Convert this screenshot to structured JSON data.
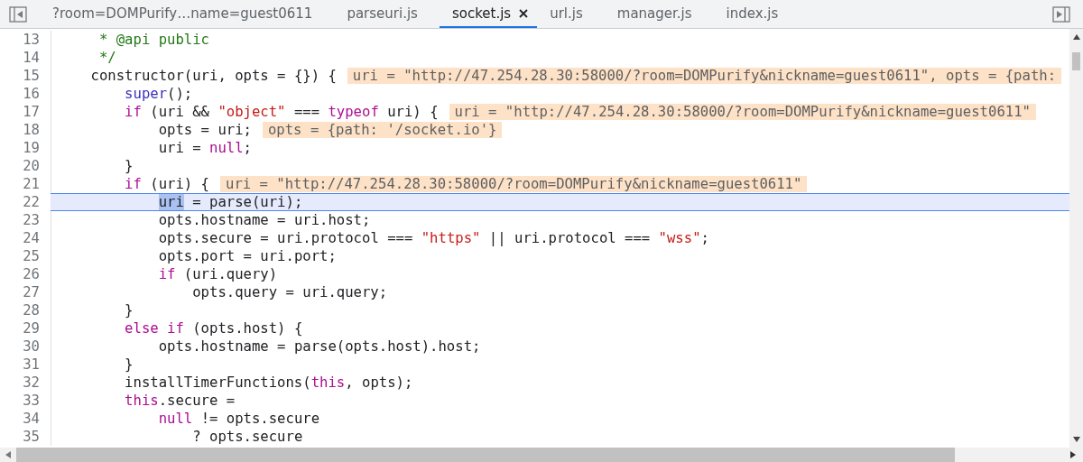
{
  "tabs": [
    {
      "label": "?room=DOMPurify…name=guest0611",
      "selected": false
    },
    {
      "label": "parseuri.js",
      "selected": false
    },
    {
      "label": "socket.js",
      "selected": true
    },
    {
      "label": "url.js",
      "selected": false
    },
    {
      "label": "manager.js",
      "selected": false
    },
    {
      "label": "index.js",
      "selected": false
    }
  ],
  "editor": {
    "lines": [
      {
        "number": "13",
        "selected": false,
        "tokens": [
          {
            "kind": "comment",
            "text": "     * @api public"
          }
        ]
      },
      {
        "number": "14",
        "selected": false,
        "tokens": [
          {
            "kind": "comment",
            "text": "     */"
          }
        ]
      },
      {
        "number": "15",
        "selected": false,
        "tokens": [
          {
            "kind": "plain",
            "text": "    constructor(uri, opts = {}) {"
          }
        ],
        "value": "uri = \"http://47.254.28.30:58000/?room=DOMPurify&nickname=guest0611\", opts = {path:"
      },
      {
        "number": "16",
        "selected": false,
        "tokens": [
          {
            "kind": "builtin",
            "text": "        super"
          },
          {
            "kind": "plain",
            "text": "();"
          }
        ]
      },
      {
        "number": "17",
        "selected": false,
        "tokens": [
          {
            "kind": "keyword",
            "text": "        if"
          },
          {
            "kind": "plain",
            "text": " (uri && "
          },
          {
            "kind": "string",
            "text": "\"object\""
          },
          {
            "kind": "plain",
            "text": " === "
          },
          {
            "kind": "keyword",
            "text": "typeof"
          },
          {
            "kind": "plain",
            "text": " uri) {"
          }
        ],
        "value": "uri = \"http://47.254.28.30:58000/?room=DOMPurify&nickname=guest0611\""
      },
      {
        "number": "18",
        "selected": false,
        "tokens": [
          {
            "kind": "plain",
            "text": "            opts = uri;"
          }
        ],
        "value": "opts = {path: '/socket.io'}"
      },
      {
        "number": "19",
        "selected": false,
        "tokens": [
          {
            "kind": "plain",
            "text": "            uri = "
          },
          {
            "kind": "keyword",
            "text": "null"
          },
          {
            "kind": "plain",
            "text": ";"
          }
        ]
      },
      {
        "number": "20",
        "selected": false,
        "tokens": [
          {
            "kind": "plain",
            "text": "        }"
          }
        ]
      },
      {
        "number": "21",
        "selected": false,
        "tokens": [
          {
            "kind": "keyword",
            "text": "        if"
          },
          {
            "kind": "plain",
            "text": " (uri) {"
          }
        ],
        "value": "uri = \"http://47.254.28.30:58000/?room=DOMPurify&nickname=guest0611\""
      },
      {
        "number": "22",
        "selected": true,
        "tokens": [
          {
            "kind": "selection",
            "text": "            uri"
          },
          {
            "kind": "plain",
            "text": " = parse(uri);"
          }
        ]
      },
      {
        "number": "23",
        "selected": false,
        "tokens": [
          {
            "kind": "plain",
            "text": "            opts.hostname = uri.host;"
          }
        ]
      },
      {
        "number": "24",
        "selected": false,
        "tokens": [
          {
            "kind": "plain",
            "text": "            opts.secure = uri.protocol === "
          },
          {
            "kind": "string",
            "text": "\"https\""
          },
          {
            "kind": "plain",
            "text": " || uri.protocol === "
          },
          {
            "kind": "string",
            "text": "\"wss\""
          },
          {
            "kind": "plain",
            "text": ";"
          }
        ]
      },
      {
        "number": "25",
        "selected": false,
        "tokens": [
          {
            "kind": "plain",
            "text": "            opts.port = uri.port;"
          }
        ]
      },
      {
        "number": "26",
        "selected": false,
        "tokens": [
          {
            "kind": "keyword",
            "text": "            if"
          },
          {
            "kind": "plain",
            "text": " (uri.query)"
          }
        ]
      },
      {
        "number": "27",
        "selected": false,
        "tokens": [
          {
            "kind": "plain",
            "text": "                opts.query = uri.query;"
          }
        ]
      },
      {
        "number": "28",
        "selected": false,
        "tokens": [
          {
            "kind": "plain",
            "text": "        }"
          }
        ]
      },
      {
        "number": "29",
        "selected": false,
        "tokens": [
          {
            "kind": "keyword",
            "text": "        else if"
          },
          {
            "kind": "plain",
            "text": " (opts.host) {"
          }
        ]
      },
      {
        "number": "30",
        "selected": false,
        "tokens": [
          {
            "kind": "plain",
            "text": "            opts.hostname = parse(opts.host).host;"
          }
        ]
      },
      {
        "number": "31",
        "selected": false,
        "tokens": [
          {
            "kind": "plain",
            "text": "        }"
          }
        ]
      },
      {
        "number": "32",
        "selected": false,
        "tokens": [
          {
            "kind": "plain",
            "text": "        installTimerFunctions("
          },
          {
            "kind": "keyword",
            "text": "this"
          },
          {
            "kind": "plain",
            "text": ", opts);"
          }
        ]
      },
      {
        "number": "33",
        "selected": false,
        "tokens": [
          {
            "kind": "keyword",
            "text": "        this"
          },
          {
            "kind": "plain",
            "text": ".secure ="
          }
        ]
      },
      {
        "number": "34",
        "selected": false,
        "tokens": [
          {
            "kind": "keyword",
            "text": "            null"
          },
          {
            "kind": "plain",
            "text": " != opts.secure"
          }
        ]
      },
      {
        "number": "35",
        "selected": false,
        "tokens": [
          {
            "kind": "plain",
            "text": "                ? opts.secure"
          }
        ]
      }
    ]
  }
}
